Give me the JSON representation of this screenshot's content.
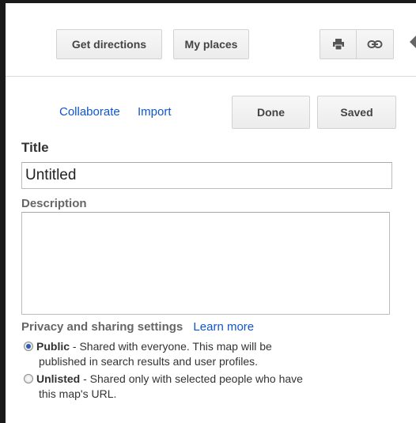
{
  "toolbar": {
    "get_directions": "Get directions",
    "my_places": "My places",
    "print_icon": "print-icon",
    "link_icon": "link-icon"
  },
  "actions": {
    "collaborate": "Collaborate",
    "import": "Import",
    "done": "Done",
    "saved": "Saved"
  },
  "form": {
    "title_label": "Title",
    "title_value": "Untitled",
    "description_label": "Description",
    "description_value": ""
  },
  "privacy": {
    "label": "Privacy and sharing settings",
    "learn_more": "Learn more",
    "options": [
      {
        "name": "Public",
        "desc_line1": " - Shared with everyone. This map will be",
        "desc_line2": "published in search results and user profiles.",
        "selected": true
      },
      {
        "name": "Unlisted",
        "desc_line1": " - Shared only with selected people who have",
        "desc_line2": "this map's URL.",
        "selected": false
      }
    ]
  },
  "colors": {
    "link": "#1155cc",
    "frame": "#1a1a1a",
    "radio_selected": "#2a5db0"
  }
}
